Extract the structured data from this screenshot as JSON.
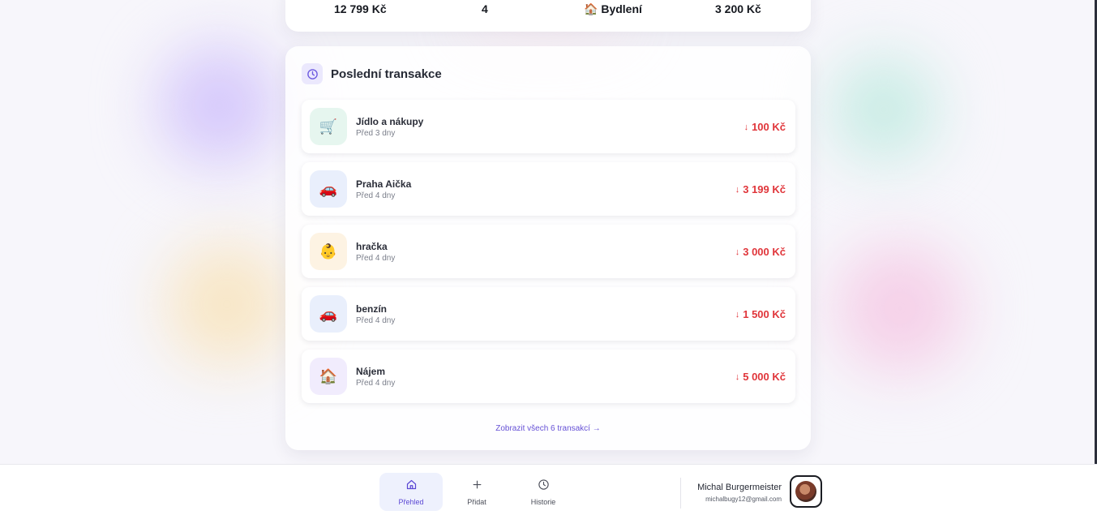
{
  "summary": {
    "total_amount": "12 799 Kč",
    "count": "4",
    "top_category_icon": "🏠",
    "top_category": "Bydlení",
    "top_category_amount": "3 200 Kč"
  },
  "recent": {
    "title": "Poslední transakce",
    "header_icon": "clock-icon",
    "transactions": [
      {
        "name": "Jídlo a nákupy",
        "date": "Před 3 dny",
        "amount": "100 Kč",
        "icon": "🛒",
        "icon_name": "cart-icon",
        "icon_bg": "#e6f6ef"
      },
      {
        "name": "Praha Aička",
        "date": "Před 4 dny",
        "amount": "3 199 Kč",
        "icon": "🚗",
        "icon_name": "car-icon",
        "icon_bg": "#e9effc"
      },
      {
        "name": "hračka",
        "date": "Před 4 dny",
        "amount": "3 000 Kč",
        "icon": "👶",
        "icon_name": "baby-icon",
        "icon_bg": "#fdf3e3"
      },
      {
        "name": "benzín",
        "date": "Před 4 dny",
        "amount": "1 500 Kč",
        "icon": "🚗",
        "icon_name": "car-icon",
        "icon_bg": "#e9effc"
      },
      {
        "name": "Nájem",
        "date": "Před 4 dny",
        "amount": "5 000 Kč",
        "icon": "🏠",
        "icon_name": "house-icon",
        "icon_bg": "#f1ecfd"
      }
    ],
    "view_all_label": "Zobrazit všech 6 transakcí →",
    "amount_color": "#e0353a"
  },
  "nav": {
    "items": [
      {
        "label": "Přehled",
        "icon": "home-icon",
        "active": true
      },
      {
        "label": "Přidat",
        "icon": "plus-icon",
        "active": false
      },
      {
        "label": "Historie",
        "icon": "clock-icon",
        "active": false
      }
    ]
  },
  "user": {
    "name": "Michal Burgermeister",
    "email": "michalbugy12@gmail.com"
  },
  "colors": {
    "accent": "#5b48d4",
    "expense": "#e0353a"
  }
}
